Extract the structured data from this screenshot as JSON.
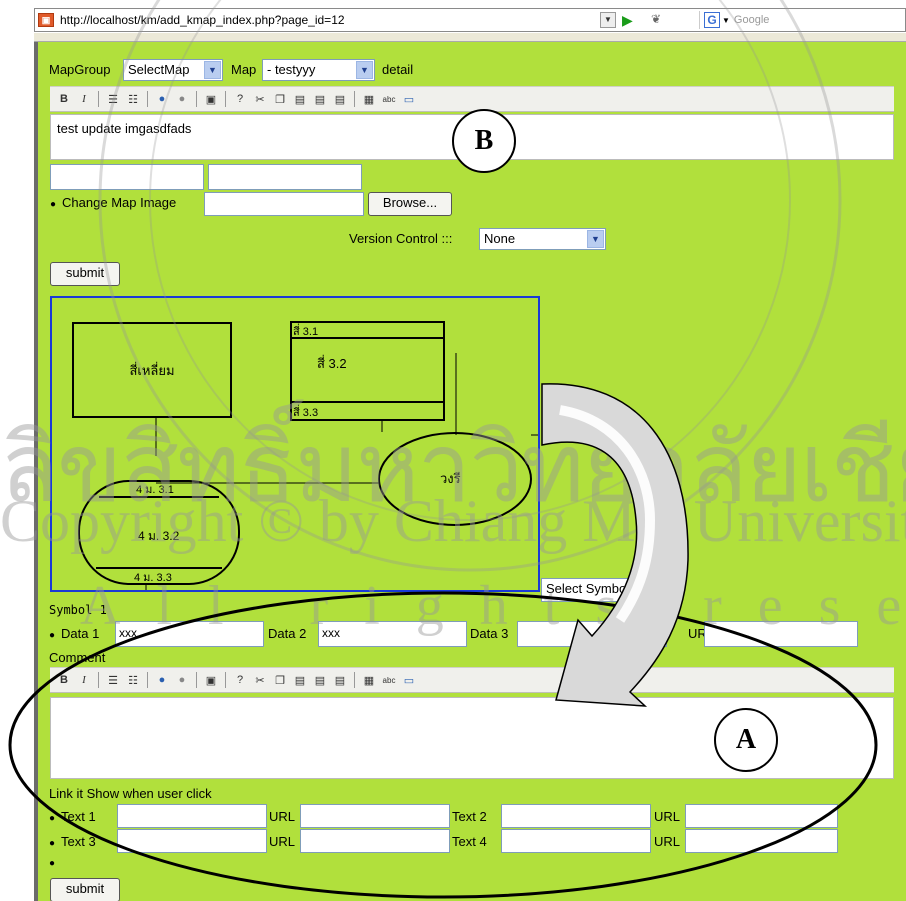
{
  "browser": {
    "url": "http://localhost/km/add_kmap_index.php?page_id=12",
    "search_placeholder": "Google"
  },
  "top": {
    "mapgroup_label": "MapGroup",
    "mapgroup_select": "SelectMap",
    "map_label": "Map",
    "map_select": "- testyyy",
    "detail_label": "detail",
    "editor_text": "test update imgasdfads",
    "change_map_image_label": "Change Map Image",
    "browse_button": "Browse...",
    "version_control_label": "Version Control :::",
    "version_control_select": "None",
    "submit_button": "submit"
  },
  "diagram": {
    "rect_label": "สี่เหลี่ยม",
    "table_rows": [
      "สี่ 3.1",
      "สี่ 3.2",
      "สี่ 3.3"
    ],
    "ellipse_label": "วงรี",
    "rounded_rows": [
      "4 ม. 3.1",
      "4 ม. 3.2",
      "4 ม. 3.3"
    ]
  },
  "symbol": {
    "select_symbol": "Select Symbol",
    "symbol_title": "Symbol 1",
    "data1_label": "Data 1",
    "data1_value": "xxx",
    "data2_label": "Data 2",
    "data2_value": "xxx",
    "data3_label": "Data 3",
    "url_label": "URL",
    "comment_label": "Comment"
  },
  "links": {
    "heading": "Link it Show when user click",
    "text1_label": "Text 1",
    "text2_label": "Text 2",
    "text3_label": "Text 3",
    "text4_label": "Text 4",
    "url_label": "URL",
    "submit_button": "submit"
  },
  "annotations": {
    "label_a": "A",
    "label_b": "B"
  },
  "watermark": {
    "line1": "ลิขสิทธิ์มหาวิทยาลัยเชียงใหม่",
    "line2": "Copyright © by Chiang Mai University",
    "line3": "All rights reserved",
    "seal_text": "CHIANG MAI UNIVERSITY"
  }
}
